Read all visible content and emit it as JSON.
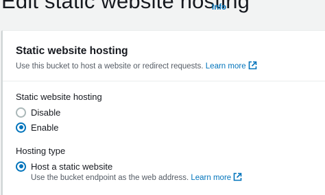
{
  "page": {
    "title": "Edit static website hosting",
    "info_link": "Info"
  },
  "panel": {
    "title": "Static website hosting",
    "description": "Use this bucket to host a website or redirect requests.",
    "learn_more": "Learn more"
  },
  "hosting_field": {
    "label": "Static website hosting",
    "options": [
      {
        "label": "Disable",
        "selected": false
      },
      {
        "label": "Enable",
        "selected": true
      }
    ]
  },
  "hosting_type": {
    "label": "Hosting type",
    "options": [
      {
        "label": "Host a static website",
        "selected": true,
        "description": "Use the bucket endpoint as the web address.",
        "learn_more": "Learn more"
      }
    ]
  },
  "icons": {
    "external_link": "external-link-icon"
  },
  "colors": {
    "link": "#0073bb",
    "radio_selected": "#0073bb",
    "radio_unselected": "#aab7b8"
  }
}
